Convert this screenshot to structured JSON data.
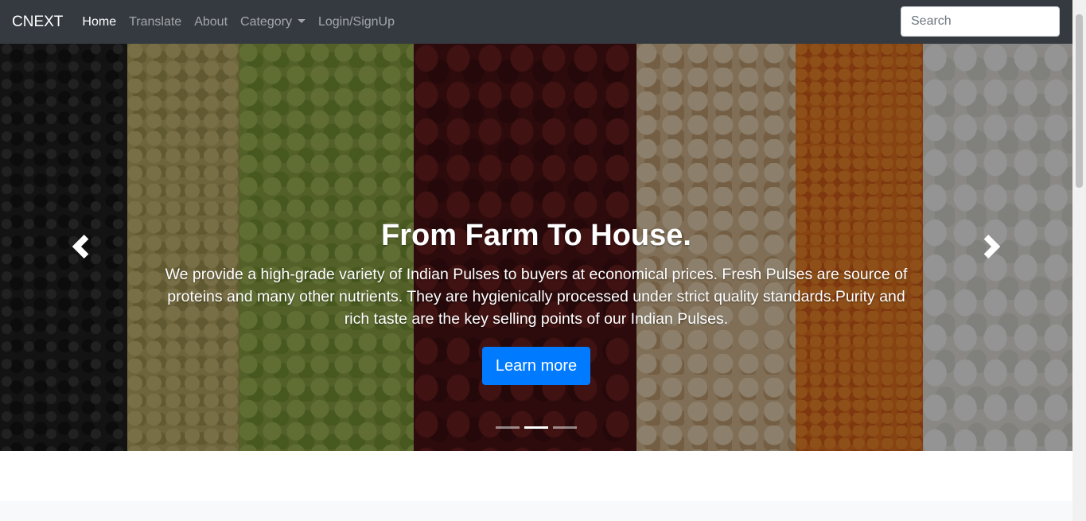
{
  "navbar": {
    "brand": "CNEXT",
    "links": [
      {
        "label": "Home",
        "active": true
      },
      {
        "label": "Translate"
      },
      {
        "label": "About"
      },
      {
        "label": "Category",
        "dropdown": true
      },
      {
        "label": "Login/SignUp"
      }
    ],
    "search_placeholder": "Search"
  },
  "carousel": {
    "title": "From Farm To House.",
    "text": "We provide a high-grade variety of Indian Pulses to buyers at economical prices. Fresh Pulses are source of proteins and many other nutrients. They are hygienically processed under strict quality standards.Purity and rich taste are the key selling points of our Indian Pulses.",
    "button": "Learn more",
    "prev_icon": "chevron-left-icon",
    "next_icon": "chevron-right-icon",
    "slide_count": 3,
    "active_slide": 2
  },
  "colors": {
    "navbar_bg": "#343a40",
    "primary": "#007bff"
  }
}
